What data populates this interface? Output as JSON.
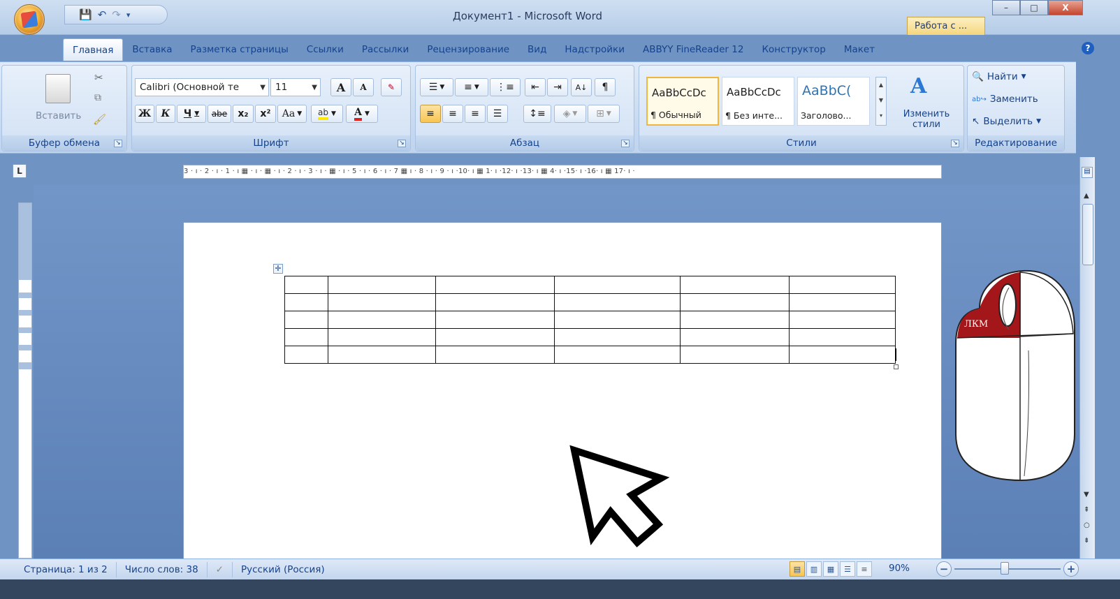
{
  "window": {
    "title": "Документ1 - Microsoft Word",
    "context_tab": "Работа с ...",
    "buttons": {
      "minimize": "–",
      "maximize": "□",
      "close": "X"
    }
  },
  "quick_access": {
    "icons": [
      "save-icon",
      "undo-icon",
      "redo-icon",
      "customize-icon"
    ]
  },
  "tabs": [
    {
      "label": "Главная",
      "active": true
    },
    {
      "label": "Вставка"
    },
    {
      "label": "Разметка страницы"
    },
    {
      "label": "Ссылки"
    },
    {
      "label": "Рассылки"
    },
    {
      "label": "Рецензирование"
    },
    {
      "label": "Вид"
    },
    {
      "label": "Надстройки"
    },
    {
      "label": "ABBYY FineReader 12"
    },
    {
      "label": "Конструктор"
    },
    {
      "label": "Макет"
    }
  ],
  "ribbon": {
    "clipboard": {
      "label": "Буфер обмена",
      "paste": "Вставить"
    },
    "font": {
      "label": "Шрифт",
      "font_name": "Calibri (Основной те",
      "font_size": "11",
      "bold": "Ж",
      "italic": "К",
      "underline": "Ч",
      "strike": "abe",
      "subscript": "x₂",
      "superscript": "x²",
      "case": "Aa",
      "grow": "A",
      "shrink": "A"
    },
    "paragraph": {
      "label": "Абзац"
    },
    "styles": {
      "label": "Стили",
      "items": [
        {
          "sample": "AaBbCcDc",
          "name": "¶ Обычный"
        },
        {
          "sample": "AaBbCcDc",
          "name": "¶ Без инте..."
        },
        {
          "sample": "AaBbC(",
          "name": "Заголово..."
        }
      ],
      "change_styles": "Изменить стили"
    },
    "editing": {
      "label": "Редактирование",
      "find": "Найти",
      "replace": "Заменить",
      "select": "Выделить"
    }
  },
  "ruler": {
    "text": "3 · ı · 2 · ı · 1 · ı ▦ · ı · ▦ · ı · 2 · ı · 3 · ı · ▦ · ı · 5 · ı · 6 · ı · 7 ▦ ı · 8 · ı · 9 · ı ·10· ı ▦ 1· ı ·12· ı ·13· ı ▦ 4· ı ·15· ı ·16· ı ▦ 17· ı ·"
  },
  "document": {
    "table": {
      "rows": 5,
      "cols": 6
    }
  },
  "overlay": {
    "mouse_label": "ЛКМ"
  },
  "status": {
    "page": "Страница: 1 из 2",
    "words": "Число слов: 38",
    "language": "Русский (Россия)",
    "zoom": "90%"
  }
}
